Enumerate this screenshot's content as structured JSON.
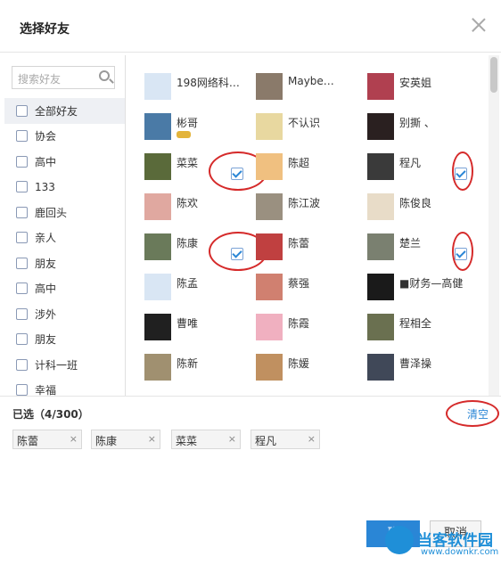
{
  "dialog": {
    "title": "选择好友",
    "close_icon": "close-icon"
  },
  "search": {
    "placeholder": "搜索好友",
    "icon": "search-icon"
  },
  "groups": [
    {
      "label": "全部好友"
    },
    {
      "label": "协会"
    },
    {
      "label": "高中"
    },
    {
      "label": "133"
    },
    {
      "label": "鹿回头"
    },
    {
      "label": "亲人"
    },
    {
      "label": "朋友"
    },
    {
      "label": "高中"
    },
    {
      "label": "涉外"
    },
    {
      "label": "朋友"
    },
    {
      "label": "计科一班"
    },
    {
      "label": "幸福"
    }
  ],
  "friends": [
    {
      "name": "198网络科…",
      "checked": false,
      "avatar": "#d9e6f4"
    },
    {
      "name": "Maybe…",
      "checked": false,
      "avatar": "#8a7a6a"
    },
    {
      "name": "安英姐",
      "checked": false,
      "avatar": "#b04050"
    },
    {
      "name": "彬哥",
      "checked": false,
      "avatar": "#4a7aa6",
      "badge": true
    },
    {
      "name": "不认识",
      "checked": false,
      "avatar": "#e8d8a0"
    },
    {
      "name": "别撕 、",
      "checked": false,
      "avatar": "#2a2020"
    },
    {
      "name": "菜菜",
      "checked": true,
      "avatar": "#5a6a3a"
    },
    {
      "name": "陈超",
      "checked": false,
      "avatar": "#f0c080"
    },
    {
      "name": "程凡",
      "checked": true,
      "avatar": "#3a3a3a"
    },
    {
      "name": "陈欢",
      "checked": false,
      "avatar": "#e0a8a0"
    },
    {
      "name": "陈江波",
      "checked": false,
      "avatar": "#9a9080"
    },
    {
      "name": "陈俊良",
      "checked": false,
      "avatar": "#e8dcc8"
    },
    {
      "name": "陈康",
      "checked": true,
      "avatar": "#6a7a5a"
    },
    {
      "name": "陈蕾",
      "checked": false,
      "avatar": "#c04040"
    },
    {
      "name": "楚兰",
      "checked": true,
      "avatar": "#7a8070"
    },
    {
      "name": "陈孟",
      "checked": false,
      "avatar": "#d9e6f4"
    },
    {
      "name": "蔡强",
      "checked": false,
      "avatar": "#d08070"
    },
    {
      "name": "■财务—高健",
      "checked": false,
      "avatar": "#1a1a1a"
    },
    {
      "name": "曹唯",
      "checked": false,
      "avatar": "#202020"
    },
    {
      "name": "陈霞",
      "checked": false,
      "avatar": "#f0b0c0"
    },
    {
      "name": "程相全",
      "checked": false,
      "avatar": "#6a7050"
    },
    {
      "name": "陈新",
      "checked": false,
      "avatar": "#a09070"
    },
    {
      "name": "陈媛",
      "checked": false,
      "avatar": "#c09060"
    },
    {
      "name": "曹泽操",
      "checked": false,
      "avatar": "#404858"
    }
  ],
  "selected": {
    "label": "已选（4/300）",
    "clear": "清空",
    "chips": [
      {
        "name": "陈蕾"
      },
      {
        "name": "陈康"
      },
      {
        "name": "菜菜"
      },
      {
        "name": "程凡"
      }
    ],
    "remove_symbol": "×"
  },
  "buttons": {
    "ok": "确",
    "cancel": "取消"
  },
  "watermark": {
    "title": "当客软件园",
    "url": "www.downkr.com"
  },
  "colors": {
    "accent": "#2a86d6",
    "highlight": "#d52a2a"
  }
}
